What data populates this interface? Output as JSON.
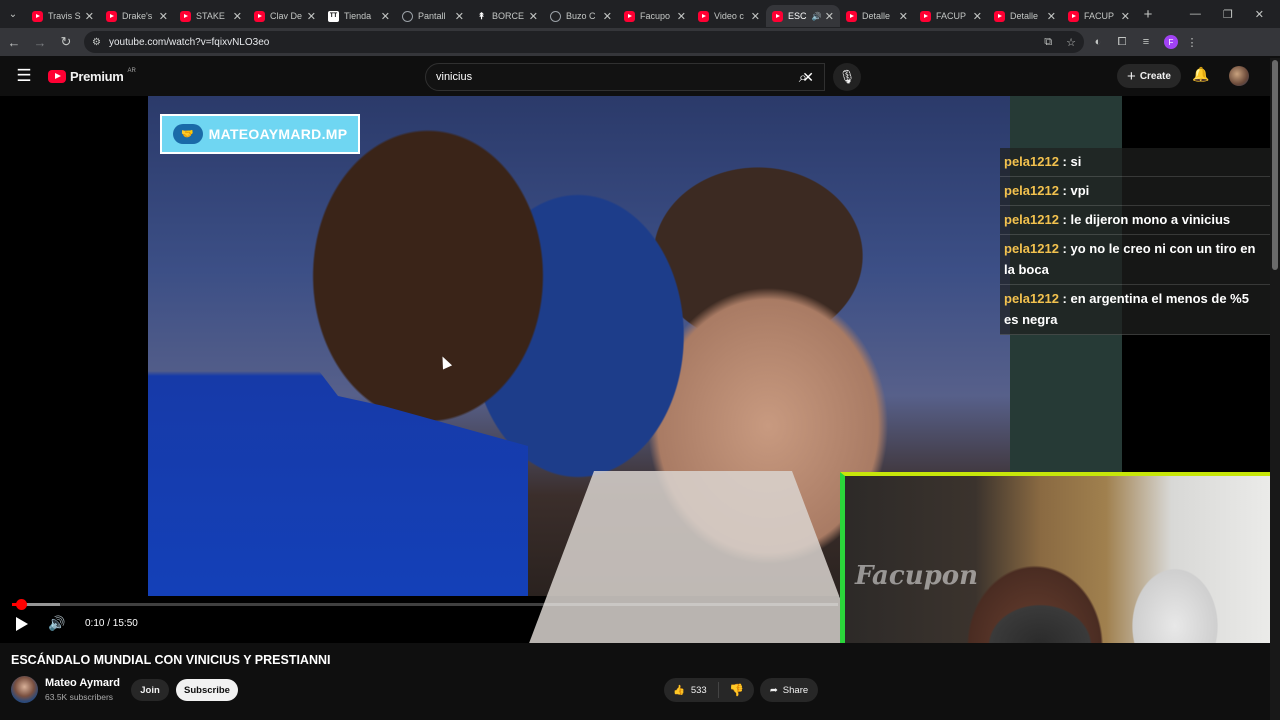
{
  "browser": {
    "tabs": [
      {
        "title": "Travis S",
        "icon": "youtube-icon"
      },
      {
        "title": "Drake's",
        "icon": "youtube-icon"
      },
      {
        "title": "STAKE",
        "icon": "youtube-icon"
      },
      {
        "title": "Clav De",
        "icon": "youtube-icon"
      },
      {
        "title": "Tienda",
        "icon": "tienda-icon"
      },
      {
        "title": "Pantall",
        "icon": "globe-icon"
      },
      {
        "title": "BORCE",
        "icon": "pin-icon"
      },
      {
        "title": "Buzo C",
        "icon": "globe-icon"
      },
      {
        "title": "Facupo",
        "icon": "youtube-icon"
      },
      {
        "title": "Video c",
        "icon": "youtube-icon"
      },
      {
        "title": "ESC",
        "icon": "youtube-icon",
        "active": true
      },
      {
        "title": "Detalle",
        "icon": "youtube-icon"
      },
      {
        "title": "FACUP",
        "icon": "youtube-icon"
      },
      {
        "title": "Detalle",
        "icon": "youtube-icon"
      },
      {
        "title": "FACUP",
        "icon": "youtube-icon"
      }
    ],
    "url": "youtube.com/watch?v=fqixvNLO3eo",
    "profile_initial": "F"
  },
  "youtube": {
    "logo_text": "Premium",
    "country_code": "AR",
    "search_query": "vinicius",
    "create_label": "Create"
  },
  "video": {
    "overlay_badge": "MATEOAYMARD.MP",
    "time_display": "0:10 / 15:50",
    "progress_played": 0.011,
    "progress_loaded": 0.058,
    "title": "ESCÁNDALO MUNDIAL CON VINICIUS Y PRESTIANNI",
    "channel_name": "Mateo Aymard",
    "subscribers": "63.5K subscribers",
    "join_label": "Join",
    "subscribe_label": "Subscribe",
    "likes": "533",
    "share_label": "Share"
  },
  "chat": [
    {
      "user": "pela1212",
      "text": "si"
    },
    {
      "user": "pela1212",
      "text": "vpi"
    },
    {
      "user": "pela1212",
      "text": "le dijeron mono a vinicius"
    },
    {
      "user": "pela1212",
      "text": "yo no le creo ni con un tiro en la boca"
    },
    {
      "user": "pela1212",
      "text": "en argentina el menos de %5 es negra"
    }
  ],
  "webcam": {
    "watermark": "Facupon"
  },
  "colors": {
    "accent_red": "#ff0033",
    "chat_username": "#f2c14e",
    "webcam_border_top": "#c7e60a",
    "webcam_border_left": "#2bd63b"
  }
}
